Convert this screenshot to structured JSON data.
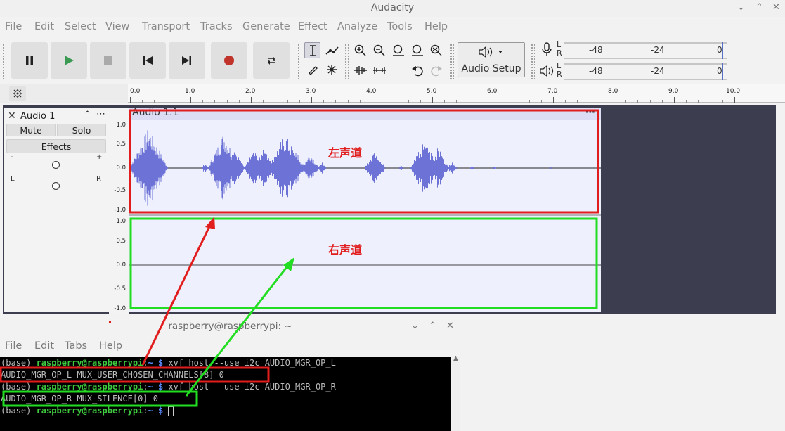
{
  "window": {
    "title": "Audacity",
    "menu": [
      "File",
      "Edit",
      "Select",
      "View",
      "Transport",
      "Tracks",
      "Generate",
      "Effect",
      "Analyze",
      "Tools",
      "Help"
    ]
  },
  "toolbar": {
    "audio_setup_label": "Audio Setup",
    "meter_scale": [
      "-48",
      "-24",
      "0"
    ],
    "meter_lr": [
      "L",
      "R"
    ]
  },
  "timeline": {
    "labels": [
      "0.0",
      "1.0",
      "2.0",
      "3.0",
      "4.0",
      "5.0",
      "6.0",
      "7.0",
      "8.0",
      "9.0",
      "10.0"
    ]
  },
  "track": {
    "name": "Audio 1",
    "mute_label": "Mute",
    "solo_label": "Solo",
    "effects_label": "Effects",
    "gain_minus": "-",
    "gain_plus": "+",
    "pan_left": "L",
    "pan_right": "R",
    "clip_name": "Audio 1.1",
    "vruler_top": [
      "1.0",
      "0.5",
      "0.0",
      "-0.5",
      "-1.0"
    ],
    "vruler_bottom": [
      "1.0",
      "0.5",
      "0.0",
      "-0.5",
      "-1.0"
    ]
  },
  "annotations": {
    "left_channel": "左声道",
    "right_channel": "右声道",
    "colors": {
      "left": "#e11d1d",
      "right": "#22dd22"
    }
  },
  "terminal": {
    "title": "raspberry@raspberrypi: ~",
    "menu": [
      "File",
      "Edit",
      "Tabs",
      "Help"
    ],
    "prompt_env": "(base) ",
    "prompt_user": "raspberry@raspberrypi",
    "prompt_sep": ":",
    "prompt_dir": "~ $",
    "lines": [
      {
        "type": "cmd",
        "text": " xvf_host --use i2c AUDIO_MGR_OP_L"
      },
      {
        "type": "out",
        "text": "AUDIO_MGR_OP_L MUX_USER_CHOSEN_CHANNELS[8] 0"
      },
      {
        "type": "cmd",
        "text": " xvf_host --use i2c AUDIO_MGR_OP_R"
      },
      {
        "type": "out",
        "text": "AUDIO_MGR_OP_R MUX_SILENCE[0] 0"
      },
      {
        "type": "cmd",
        "text": " "
      }
    ]
  }
}
